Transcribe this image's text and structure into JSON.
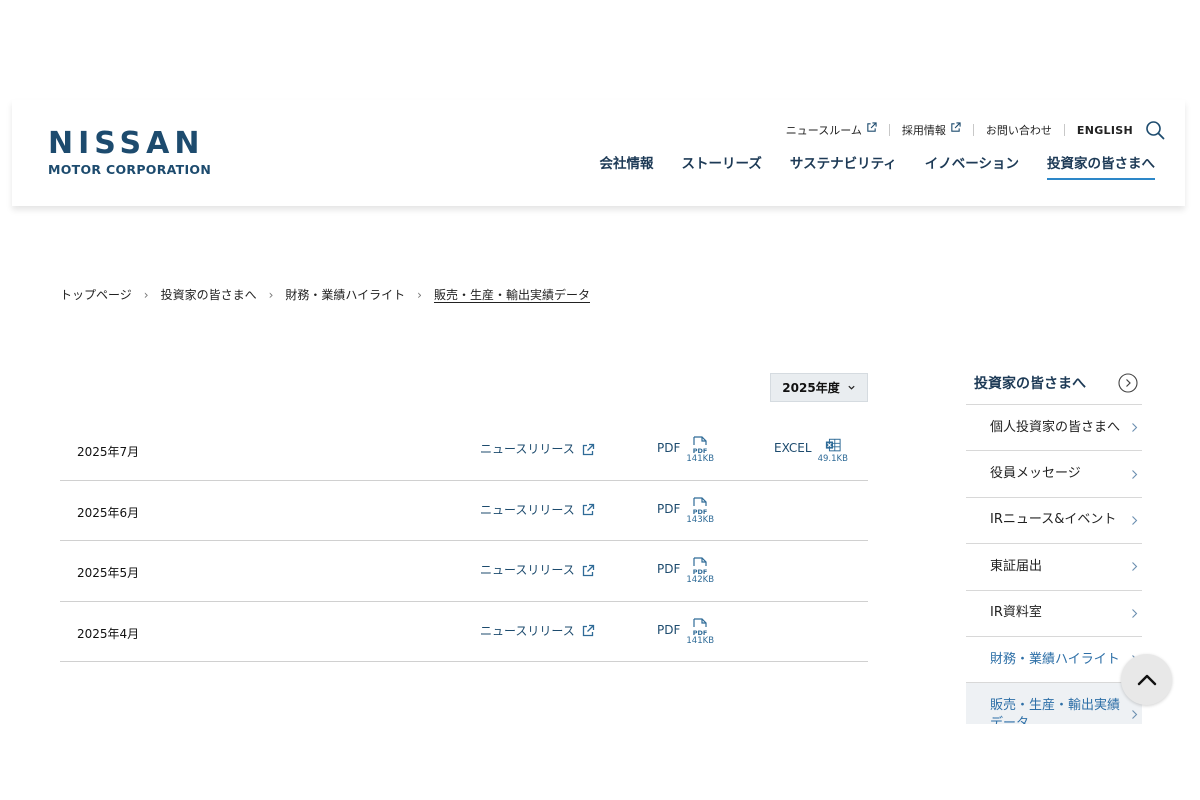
{
  "header": {
    "logo_main": "NISSAN",
    "logo_sub": "MOTOR CORPORATION",
    "util_nav": [
      {
        "label": "ニュースルーム"
      },
      {
        "label": "採用情報"
      },
      {
        "label": "お問い合わせ"
      },
      {
        "label": "ENGLISH"
      }
    ],
    "main_nav": [
      {
        "label": "会社情報"
      },
      {
        "label": "ストーリーズ"
      },
      {
        "label": "サステナビリティ"
      },
      {
        "label": "イノベーション"
      },
      {
        "label": "投資家の皆さまへ",
        "active": true
      }
    ]
  },
  "breadcrumb": [
    "トップページ",
    "投資家の皆さまへ",
    "財務・業績ハイライト",
    "販売・生産・輸出実績データ"
  ],
  "year_select": {
    "value": "2025年度"
  },
  "table": {
    "rows": [
      {
        "month": "2025年7月",
        "news": "ニュースリリース",
        "pdf": "PDF",
        "pdf_size": "141KB",
        "excel": "EXCEL",
        "excel_size": "49.1KB"
      },
      {
        "month": "2025年6月",
        "news": "ニュースリリース",
        "pdf": "PDF",
        "pdf_size": "143KB"
      },
      {
        "month": "2025年5月",
        "news": "ニュースリリース",
        "pdf": "PDF",
        "pdf_size": "142KB"
      },
      {
        "month": "2025年4月",
        "news": "ニュースリリース",
        "pdf": "PDF",
        "pdf_size": "141KB"
      }
    ]
  },
  "sidebar": {
    "title": "投資家の皆さまへ",
    "items": [
      {
        "label": "個人投資家の皆さまへ"
      },
      {
        "label": "役員メッセージ"
      },
      {
        "label": "IRニュース&イベント"
      },
      {
        "label": "東証届出"
      },
      {
        "label": "IR資料室"
      },
      {
        "label": "財務・業績ハイライト"
      },
      {
        "label": "販売・生産・輸出実績データ"
      }
    ]
  },
  "colors": {
    "brand": "#1d4b6e",
    "nav_text": "#1d3a56",
    "accent": "#2d87c8",
    "link": "#2d6fa7"
  }
}
